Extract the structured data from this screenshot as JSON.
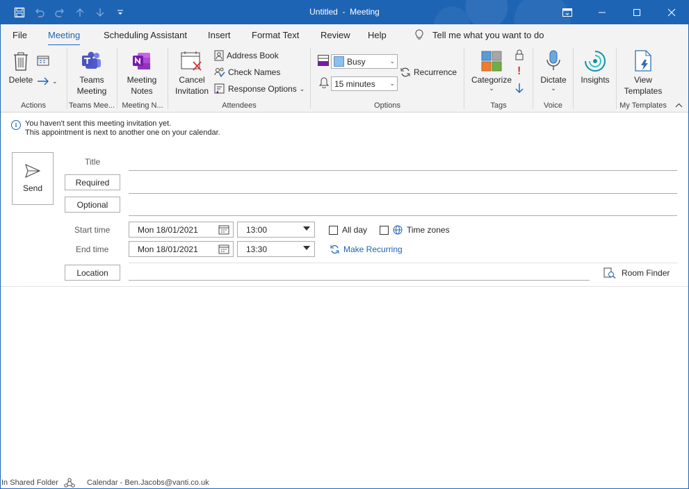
{
  "window": {
    "title": "Untitled  -  Meeting",
    "controls": [
      "minimize",
      "maximize",
      "close"
    ]
  },
  "quick_access": [
    "save-icon",
    "undo-icon",
    "redo-icon",
    "up-icon",
    "down-icon",
    "customize-icon"
  ],
  "tabs": [
    {
      "label": "File",
      "active": false
    },
    {
      "label": "Meeting",
      "active": true
    },
    {
      "label": "Scheduling Assistant",
      "active": false
    },
    {
      "label": "Insert",
      "active": false
    },
    {
      "label": "Format Text",
      "active": false
    },
    {
      "label": "Review",
      "active": false
    },
    {
      "label": "Help",
      "active": false
    }
  ],
  "tell_me": "Tell me what you want to do",
  "ribbon": {
    "actions": {
      "label": "Actions",
      "delete": "Delete"
    },
    "teams": {
      "label": "Teams Mee...",
      "button_line1": "Teams",
      "button_line2": "Meeting"
    },
    "notes": {
      "label": "Meeting N...",
      "button_line1": "Meeting",
      "button_line2": "Notes"
    },
    "attendees": {
      "label": "Attendees",
      "cancel_line1": "Cancel",
      "cancel_line2": "Invitation",
      "address_book": "Address Book",
      "check_names": "Check Names",
      "response_options": "Response Options"
    },
    "options": {
      "label": "Options",
      "show_as": "Busy",
      "reminder": "15 minutes",
      "recurrence": "Recurrence"
    },
    "tags": {
      "label": "Tags",
      "categorize": "Categorize"
    },
    "voice": {
      "label": "Voice",
      "dictate": "Dictate"
    },
    "insights": {
      "button": "Insights"
    },
    "templates": {
      "label": "My Templates",
      "line1": "View",
      "line2": "Templates"
    }
  },
  "info": {
    "line1": "You haven't sent this meeting invitation yet.",
    "line2": "This appointment is next to another one on your calendar."
  },
  "form": {
    "send": "Send",
    "title_label": "Title",
    "required": "Required",
    "optional": "Optional",
    "start_label": "Start time",
    "end_label": "End time",
    "start_date": "Mon 18/01/2021",
    "start_time": "13:00",
    "end_date": "Mon 18/01/2021",
    "end_time": "13:30",
    "all_day": "All day",
    "time_zones": "Time zones",
    "make_recurring": "Make Recurring",
    "location": "Location",
    "room_finder": "Room Finder"
  },
  "status": {
    "folder": "In Shared Folder",
    "calendar": "Calendar - Ben.Jacobs@vanti.co.uk"
  },
  "colors": {
    "accent": "#1e64b4",
    "teams": "#5059c9",
    "onenote": "#7719aa",
    "busy": "#8cc0ec"
  }
}
